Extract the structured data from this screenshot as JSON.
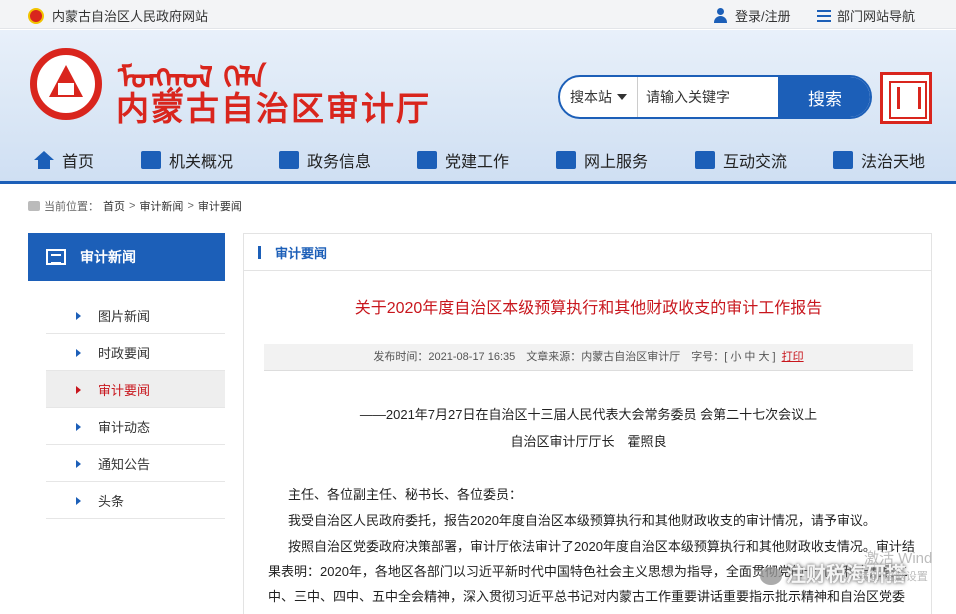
{
  "topbar": {
    "site_name": "内蒙古自治区人民政府网站",
    "login": "登录/注册",
    "nav": "部门网站导航"
  },
  "header": {
    "mongol_script": "ᠮᠣᠩᠭᠣᠯ ᠬᠡᠯᠡ",
    "title": "内蒙古自治区审计厅",
    "search_scope": "搜本站",
    "search_placeholder": "请输入关键字",
    "search_button": "搜索"
  },
  "mainnav": [
    {
      "label": "首页",
      "icon": "home-icon"
    },
    {
      "label": "机关概况",
      "icon": "building-icon"
    },
    {
      "label": "政务信息",
      "icon": "news-icon"
    },
    {
      "label": "党建工作",
      "icon": "party-icon"
    },
    {
      "label": "网上服务",
      "icon": "chart-icon"
    },
    {
      "label": "互动交流",
      "icon": "chat-icon"
    },
    {
      "label": "法治天地",
      "icon": "law-icon"
    }
  ],
  "breadcrumb": {
    "prefix": "当前位置：",
    "items": [
      "首页",
      "审计新闻",
      "审计要闻"
    ],
    "sep": ">"
  },
  "sidebar": {
    "title": "审计新闻",
    "items": [
      "图片新闻",
      "时政要闻",
      "审计要闻",
      "审计动态",
      "通知公告",
      "头条"
    ]
  },
  "content": {
    "section": "审计要闻",
    "title": "关于2020年度自治区本级预算执行和其他财政收支的审计工作报告",
    "meta": "发布时间：2021-08-17 16:35　文章来源：内蒙古自治区审计厅　字号：[ 小 中 大 ]",
    "print": "打印",
    "subtitle1": "——2021年7月27日在自治区十三届人民代表大会常务委员 会第二十七次会议上",
    "subtitle2": "自治区审计厅厅长　霍照良",
    "p1": "主任、各位副主任、秘书长、各位委员：",
    "p2": "我受自治区人民政府委托，报告2020年度自治区本级预算执行和其他财政收支的审计情况，请予审议。",
    "p3": "按照自治区党委政府决策部署，审计厅依法审计了2020年度自治区本级预算执行和其他财政收支情况。审计结果表明：2020年，各地区各部门以习近平新时代中国特色社会主义思想为指导，全面贯彻党的十九大和十九届二中、三中、四中、五中全会精神，深入贯彻习近平总书记对内蒙古工作重要讲话重要指示批示精神和自治区党委政府"
  },
  "overlay": {
    "watermark": "注财税海研搭",
    "activate1": "激活 Wind",
    "activate2": "转到\"电脑设置"
  }
}
